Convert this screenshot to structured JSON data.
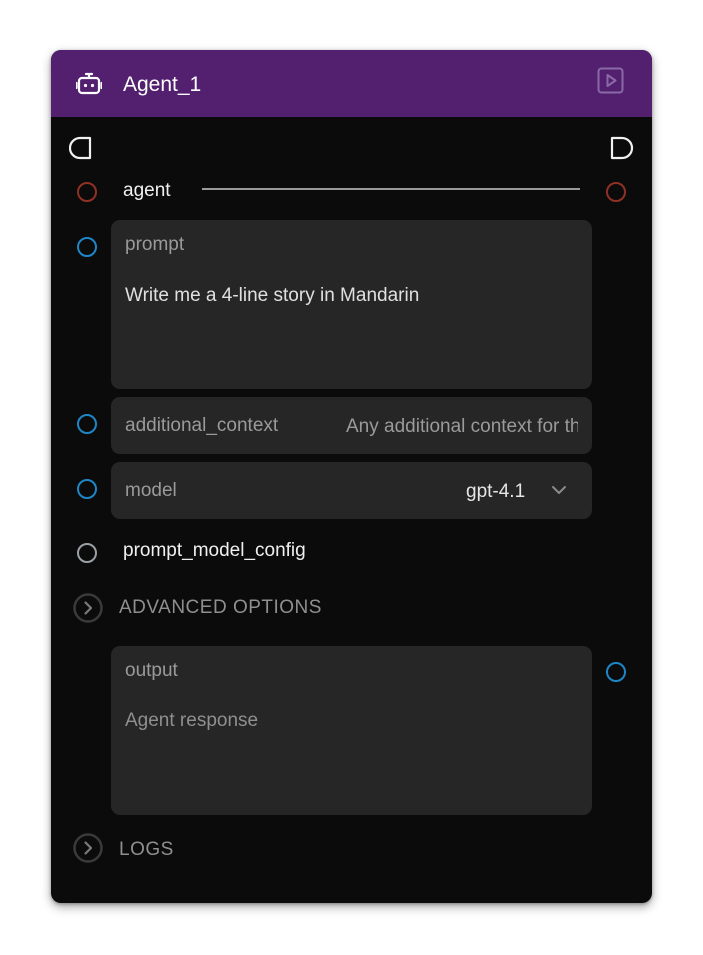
{
  "node": {
    "title": "Agent_1",
    "header_icon": "robot-icon",
    "run_icon": "play-square-icon",
    "header_color": "#52206f"
  },
  "ports": {
    "agent_label": "agent",
    "prompt_model_config_label": "prompt_model_config"
  },
  "fields": {
    "prompt": {
      "label": "prompt",
      "value": "Write me a 4-line story in Mandarin"
    },
    "additional_context": {
      "label": "additional_context",
      "placeholder": "Any additional context for the agent"
    },
    "model": {
      "label": "model",
      "value": "gpt-4.1"
    },
    "output": {
      "label": "output",
      "placeholder": "Agent response"
    }
  },
  "sections": {
    "advanced": "ADVANCED OPTIONS",
    "logs": "LOGS"
  },
  "colors": {
    "handle_blue": "#1f86c6",
    "handle_red": "#8f3126",
    "handle_grey": "#9aa0a6",
    "background": "#0b0b0b",
    "field_background": "#262626"
  }
}
